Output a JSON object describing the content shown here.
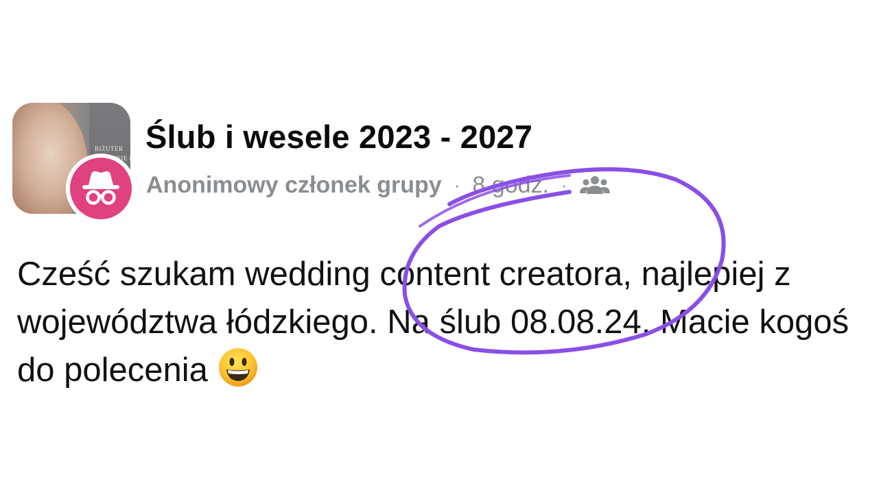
{
  "post": {
    "group_name": "Ślub i wesele 2023 - 2027",
    "author": "Anonimowy członek grupy",
    "separator": "·",
    "time": "8 godz.",
    "audience_icon": "group-members-icon",
    "body_text": "Cześć szukam wedding content creatora, najlepiej z województwa łódzkiego. Na ślub 08.08.24. Macie kogoś do polecenia",
    "emoji": "grinning-face-emoji",
    "thumbnail_text_line1": "BIŻUTER",
    "thumbnail_text_line2": "I RĘCZNIE RO"
  },
  "annotation": {
    "shape": "hand-drawn-ellipse",
    "color": "#8a4fe6"
  },
  "colors": {
    "anon_avatar_bg": "#e0417f",
    "meta_text": "#8a8d91",
    "title_text": "#0b0b0b"
  }
}
